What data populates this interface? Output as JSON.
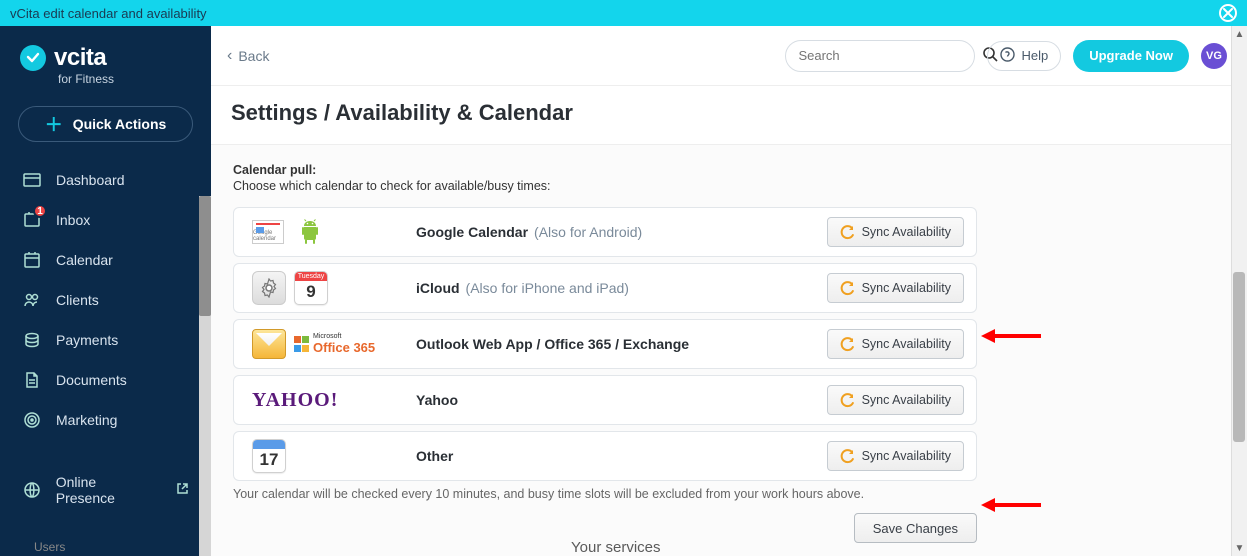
{
  "titlebar": {
    "title": "vCita edit calendar and availability"
  },
  "brand": {
    "name": "vcita",
    "sub": "for Fitness"
  },
  "quick_actions_label": "Quick Actions",
  "sidebar": {
    "items": [
      {
        "label": "Dashboard",
        "icon": "dashboard",
        "badge": null
      },
      {
        "label": "Inbox",
        "icon": "inbox",
        "badge": "1"
      },
      {
        "label": "Calendar",
        "icon": "calendar",
        "badge": null
      },
      {
        "label": "Clients",
        "icon": "clients",
        "badge": null
      },
      {
        "label": "Payments",
        "icon": "payments",
        "badge": null
      },
      {
        "label": "Documents",
        "icon": "documents",
        "badge": null
      },
      {
        "label": "Marketing",
        "icon": "marketing",
        "badge": null
      }
    ],
    "online_presence": "Online Presence",
    "peek_label": "Users"
  },
  "topbar": {
    "back": "Back",
    "search_placeholder": "Search",
    "help": "Help",
    "upgrade": "Upgrade Now",
    "avatar_initials": "VG"
  },
  "heading": "Settings / Availability & Calendar",
  "section": {
    "label": "Calendar pull:",
    "sublabel": "Choose which calendar to check for available/busy times:"
  },
  "providers": [
    {
      "name": "Google Calendar",
      "note": "(Also for Android)",
      "sync": "Sync Availability"
    },
    {
      "name": "iCloud",
      "note": "(Also for iPhone and iPad)",
      "sync": "Sync Availability"
    },
    {
      "name": "Outlook Web App / Office 365 / Exchange",
      "note": "",
      "sync": "Sync Availability"
    },
    {
      "name": "Yahoo",
      "note": "",
      "sync": "Sync Availability"
    },
    {
      "name": "Other",
      "note": "",
      "sync": "Sync Availability"
    }
  ],
  "cal_day_label": "Tuesday",
  "cal_day_num_9": "9",
  "cal_day_num_17": "17",
  "gcal_label": "Google calendar",
  "office_label_prefix": "Microsoft",
  "office_label_main": "Office 365",
  "yahoo_logo_text": "YAHOO!",
  "footer_note": "Your calendar will be checked every 10 minutes, and busy time slots will be excluded from your work hours above.",
  "save_label": "Save Changes",
  "bottom_peek": "Your services"
}
